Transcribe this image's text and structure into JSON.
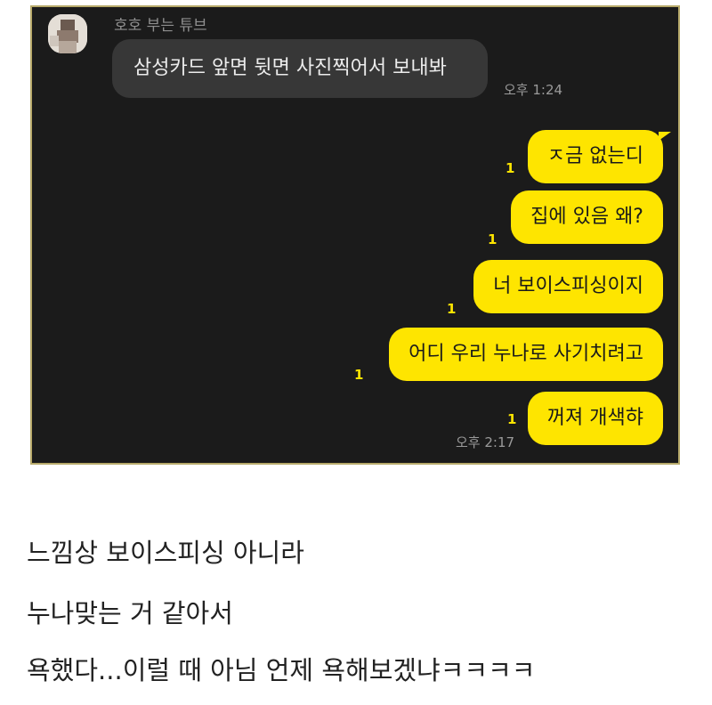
{
  "chat": {
    "sender_name": "호호 부는 튜브",
    "received": {
      "text": "삼성카드 앞면 뒷면 사진찍어서 보내봐",
      "time": "오후 1:24"
    },
    "sent": [
      {
        "text": "ㅈ금 없는디",
        "unread": "1"
      },
      {
        "text": "집에 있음 왜?",
        "unread": "1"
      },
      {
        "text": "너 보이스피싱이지",
        "unread": "1"
      },
      {
        "text": "어디 우리 누나로 사기치려고",
        "unread": "1"
      },
      {
        "text": "꺼져 개색햐",
        "unread": "1"
      }
    ],
    "sent_time": "오후 2:17",
    "colors": {
      "background": "#1b1b1b",
      "sent_bubble": "#fee500",
      "received_bubble": "#373737",
      "unread": "#fee500"
    }
  },
  "caption": [
    "느낌상 보이스피싱 아니라",
    "누나맞는 거 같아서",
    "욕했다...이럴 때 아님 언제 욕해보겠냐ㅋㅋㅋㅋ"
  ]
}
